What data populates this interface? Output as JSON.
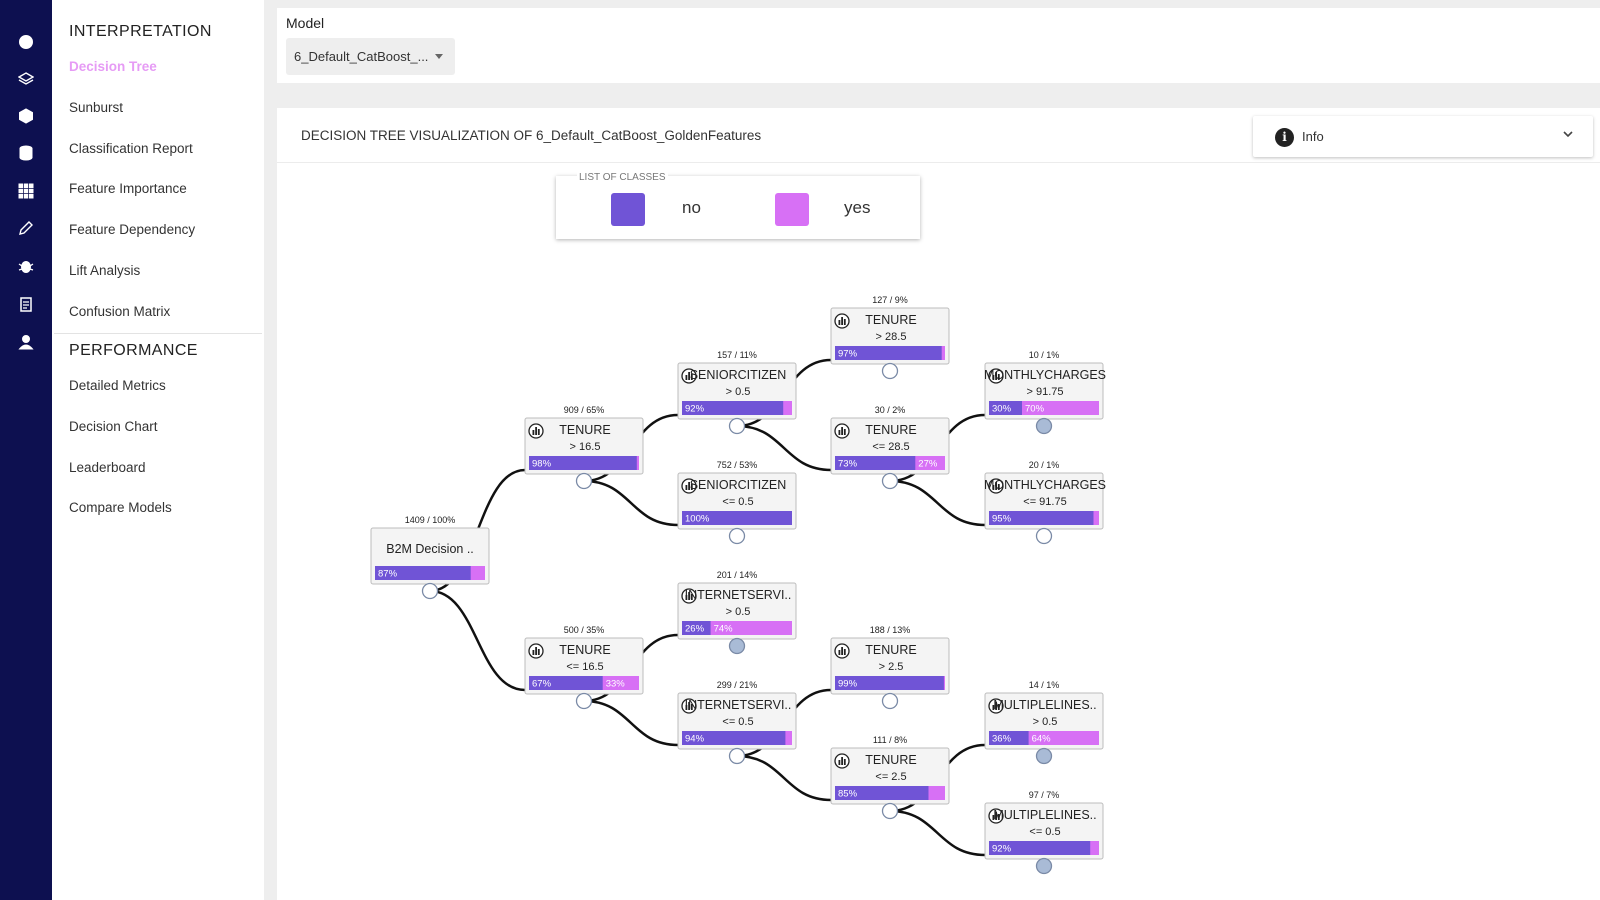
{
  "colors": {
    "rail_bg": "#0d1050",
    "class_no": "#7054d6",
    "class_yes": "#d770f5",
    "active_menu": "#e69bf5"
  },
  "rail": {
    "icons": [
      "brain-icon",
      "layers-icon",
      "cube-icon",
      "database-icon",
      "grid-icon",
      "pencil-icon",
      "bug-icon",
      "clipboard-icon",
      "user-icon"
    ]
  },
  "sidebar": {
    "interpretation_title": "INTERPRETATION",
    "interpretation_items": [
      "Decision Tree",
      "Sunburst",
      "Classification Report",
      "Feature Importance",
      "Feature Dependency",
      "Lift Analysis",
      "Confusion Matrix"
    ],
    "performance_title": "PERFORMANCE",
    "performance_items": [
      "Detailed Metrics",
      "Decision Chart",
      "Leaderboard",
      "Compare Models"
    ],
    "active_item": "Decision Tree"
  },
  "model": {
    "label": "Model",
    "selected": "6_Default_CatBoost_..."
  },
  "viz": {
    "title": "DECISION TREE VISUALIZATION OF 6_Default_CatBoost_GoldenFeatures",
    "info_label": "Info"
  },
  "legend": {
    "title": "LIST OF CLASSES",
    "classes": [
      {
        "name": "no",
        "color": "#7054d6"
      },
      {
        "name": "yes",
        "color": "#d770f5"
      }
    ]
  },
  "tree": {
    "nodes": [
      {
        "id": "root",
        "count": "1409 / 100%",
        "label": "B2M Decision ..",
        "cond": "",
        "no": 87,
        "no_text": "87%",
        "yes_text": "",
        "icon": false
      },
      {
        "id": "n1",
        "count": "909 / 65%",
        "label": "TENURE",
        "cond": "> 16.5",
        "no": 98,
        "no_text": "98%",
        "yes_text": "",
        "icon": true
      },
      {
        "id": "n2",
        "count": "500 / 35%",
        "label": "TENURE",
        "cond": "<= 16.5",
        "no": 67,
        "no_text": "67%",
        "yes_text": "33%",
        "icon": true
      },
      {
        "id": "n3",
        "count": "157 / 11%",
        "label": "SENIORCITIZEN",
        "cond": "> 0.5",
        "no": 92,
        "no_text": "92%",
        "yes_text": "",
        "icon": true
      },
      {
        "id": "n4",
        "count": "752 / 53%",
        "label": "SENIORCITIZEN",
        "cond": "<= 0.5",
        "no": 100,
        "no_text": "100%",
        "yes_text": "",
        "icon": true
      },
      {
        "id": "n5",
        "count": "201 / 14%",
        "label": "INTERNETSERVI..",
        "cond": "> 0.5",
        "no": 26,
        "no_text": "26%",
        "yes_text": "74%",
        "icon": true
      },
      {
        "id": "n6",
        "count": "299 / 21%",
        "label": "INTERNETSERVI..",
        "cond": "<= 0.5",
        "no": 94,
        "no_text": "94%",
        "yes_text": "",
        "icon": true
      },
      {
        "id": "n7",
        "count": "127 / 9%",
        "label": "TENURE",
        "cond": "> 28.5",
        "no": 97,
        "no_text": "97%",
        "yes_text": "",
        "icon": true
      },
      {
        "id": "n8",
        "count": "30 / 2%",
        "label": "TENURE",
        "cond": "<= 28.5",
        "no": 73,
        "no_text": "73%",
        "yes_text": "27%",
        "icon": true
      },
      {
        "id": "n9",
        "count": "188 / 13%",
        "label": "TENURE",
        "cond": "> 2.5",
        "no": 99,
        "no_text": "99%",
        "yes_text": "",
        "icon": true
      },
      {
        "id": "n10",
        "count": "111 / 8%",
        "label": "TENURE",
        "cond": "<= 2.5",
        "no": 85,
        "no_text": "85%",
        "yes_text": "",
        "icon": true
      },
      {
        "id": "n11",
        "count": "10 / 1%",
        "label": "MONTHLYCHARGES",
        "cond": "> 91.75",
        "no": 30,
        "no_text": "30%",
        "yes_text": "70%",
        "icon": true
      },
      {
        "id": "n12",
        "count": "20 / 1%",
        "label": "MONTHLYCHARGES",
        "cond": "<= 91.75",
        "no": 95,
        "no_text": "95%",
        "yes_text": "",
        "icon": true
      },
      {
        "id": "n13",
        "count": "14 / 1%",
        "label": "MULTIPLELINES..",
        "cond": "> 0.5",
        "no": 36,
        "no_text": "36%",
        "yes_text": "64%",
        "icon": true
      },
      {
        "id": "n14",
        "count": "97 / 7%",
        "label": "MULTIPLELINES..",
        "cond": "<= 0.5",
        "no": 92,
        "no_text": "92%",
        "yes_text": "",
        "icon": true
      }
    ],
    "edges": [
      [
        "root",
        "n1"
      ],
      [
        "root",
        "n2"
      ],
      [
        "n1",
        "n3"
      ],
      [
        "n1",
        "n4"
      ],
      [
        "n2",
        "n5"
      ],
      [
        "n2",
        "n6"
      ],
      [
        "n3",
        "n7"
      ],
      [
        "n3",
        "n8"
      ],
      [
        "n6",
        "n9"
      ],
      [
        "n6",
        "n10"
      ],
      [
        "n8",
        "n11"
      ],
      [
        "n8",
        "n12"
      ],
      [
        "n10",
        "n13"
      ],
      [
        "n10",
        "n14"
      ]
    ],
    "leaf_filled": [
      "n5",
      "n11",
      "n13",
      "n14"
    ]
  }
}
